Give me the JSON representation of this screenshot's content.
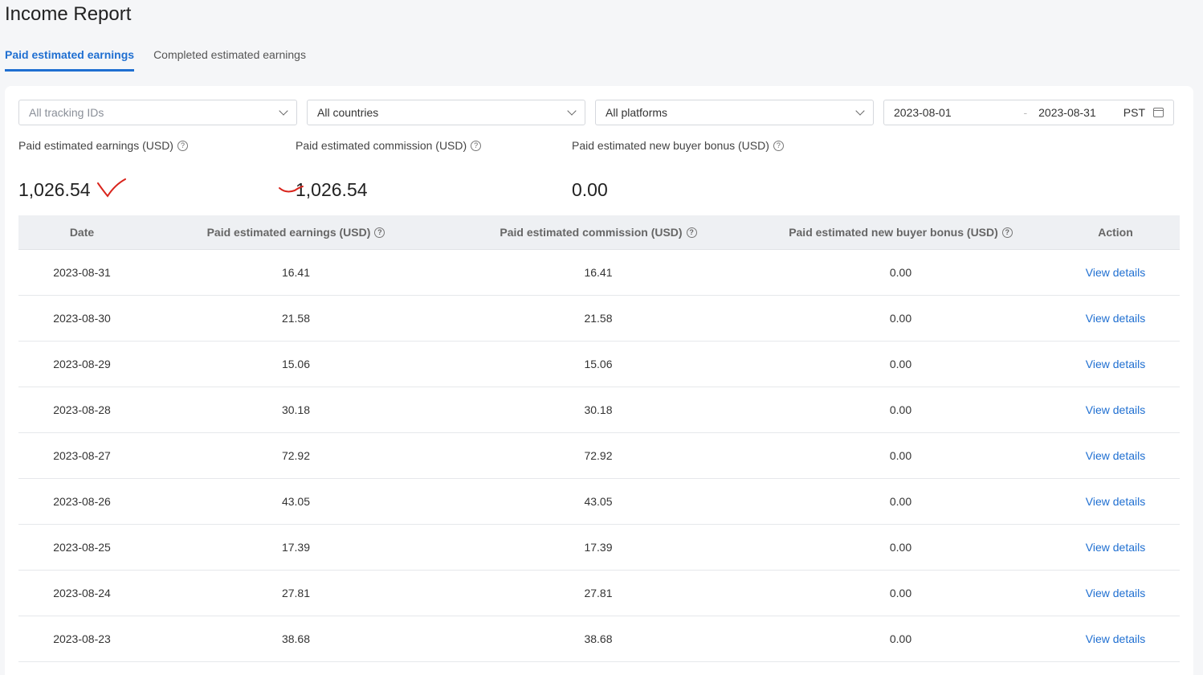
{
  "page": {
    "title": "Income Report"
  },
  "tabs": [
    {
      "label": "Paid estimated earnings",
      "active": true
    },
    {
      "label": "Completed estimated earnings",
      "active": false
    }
  ],
  "filters": {
    "tracking": {
      "value": "All tracking IDs",
      "placeholder": true
    },
    "country": {
      "value": "All countries"
    },
    "platform": {
      "value": "All platforms"
    },
    "date_start": "2023-08-01",
    "date_sep": "-",
    "date_end": "2023-08-31",
    "timezone": "PST"
  },
  "summary": [
    {
      "label": "Paid estimated earnings (USD)",
      "value": "1,026.54"
    },
    {
      "label": "Paid estimated commission (USD)",
      "value": "1,026.54"
    },
    {
      "label": "Paid estimated new buyer bonus (USD)",
      "value": "0.00"
    }
  ],
  "table": {
    "headers": [
      "Date",
      "Paid estimated earnings (USD)",
      "Paid estimated commission (USD)",
      "Paid estimated new buyer bonus (USD)",
      "Action"
    ],
    "help_icon": "?",
    "rows": [
      {
        "date": "2023-08-31",
        "earnings": "16.41",
        "commission": "16.41",
        "bonus": "0.00",
        "action": "View details"
      },
      {
        "date": "2023-08-30",
        "earnings": "21.58",
        "commission": "21.58",
        "bonus": "0.00",
        "action": "View details"
      },
      {
        "date": "2023-08-29",
        "earnings": "15.06",
        "commission": "15.06",
        "bonus": "0.00",
        "action": "View details"
      },
      {
        "date": "2023-08-28",
        "earnings": "30.18",
        "commission": "30.18",
        "bonus": "0.00",
        "action": "View details"
      },
      {
        "date": "2023-08-27",
        "earnings": "72.92",
        "commission": "72.92",
        "bonus": "0.00",
        "action": "View details"
      },
      {
        "date": "2023-08-26",
        "earnings": "43.05",
        "commission": "43.05",
        "bonus": "0.00",
        "action": "View details"
      },
      {
        "date": "2023-08-25",
        "earnings": "17.39",
        "commission": "17.39",
        "bonus": "0.00",
        "action": "View details"
      },
      {
        "date": "2023-08-24",
        "earnings": "27.81",
        "commission": "27.81",
        "bonus": "0.00",
        "action": "View details"
      },
      {
        "date": "2023-08-23",
        "earnings": "38.68",
        "commission": "38.68",
        "bonus": "0.00",
        "action": "View details"
      }
    ]
  },
  "colors": {
    "accent": "#1f6fd1",
    "annotation": "#d9241c"
  }
}
